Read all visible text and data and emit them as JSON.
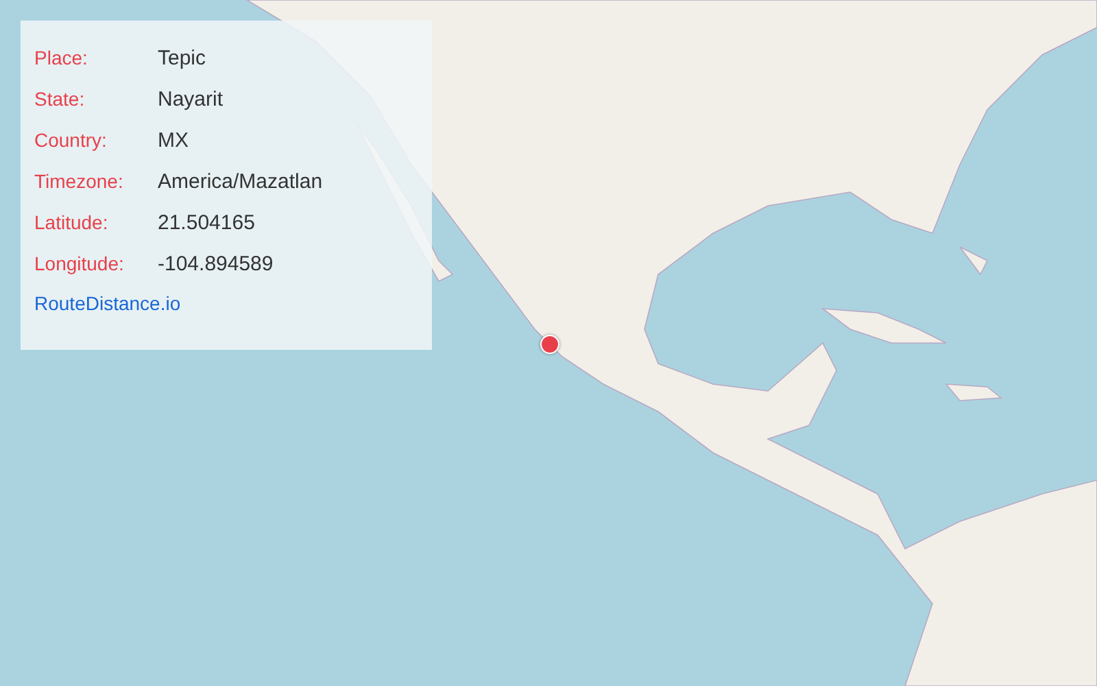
{
  "info_panel": {
    "fields": [
      {
        "label": "Place:",
        "value": "Tepic"
      },
      {
        "label": "State:",
        "value": "Nayarit"
      },
      {
        "label": "Country:",
        "value": "MX"
      },
      {
        "label": "Timezone:",
        "value": "America/Mazatlan"
      },
      {
        "label": "Latitude:",
        "value": "21.504165"
      },
      {
        "label": "Longitude:",
        "value": "-104.894589"
      }
    ],
    "link": "RouteDistance.io"
  }
}
